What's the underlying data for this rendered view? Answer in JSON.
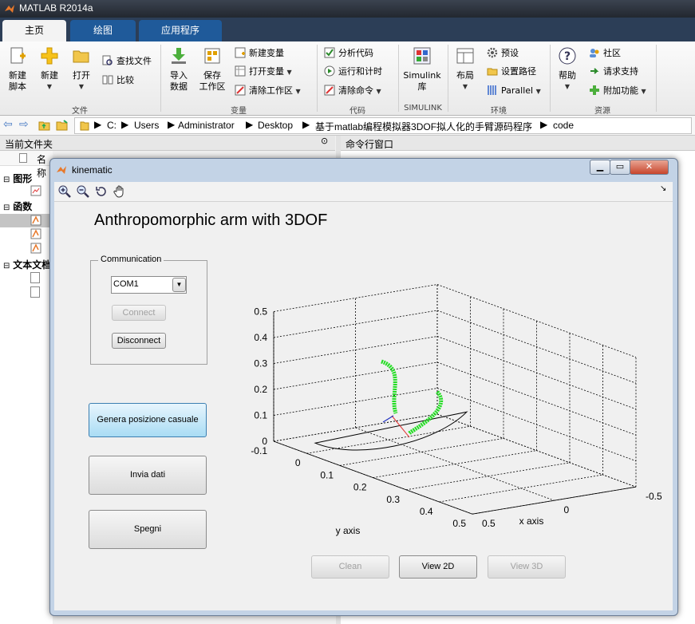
{
  "app": {
    "title": "MATLAB R2014a"
  },
  "tabs": [
    {
      "label": "主页"
    },
    {
      "label": "绘图"
    },
    {
      "label": "应用程序"
    }
  ],
  "ribbon": {
    "file": {
      "new_script": "新建\n脚本",
      "new": "新建",
      "open": "打开",
      "find_files": "查找文件",
      "compare": "比较",
      "group": "文件"
    },
    "variable": {
      "import": "导入\n数据",
      "save_ws": "保存\n工作区",
      "new_var": "新建变量",
      "open_var": "打开变量",
      "clear_ws": "清除工作区",
      "group": "变量"
    },
    "code": {
      "analyze": "分析代码",
      "run_time": "运行和计时",
      "clear_cmd": "清除命令",
      "group": "代码"
    },
    "simulink": {
      "lib": "Simulink\n库",
      "group": "SIMULINK"
    },
    "env": {
      "layout": "布局",
      "prefs": "预设",
      "set_path": "设置路径",
      "parallel": "Parallel",
      "group": "环境"
    },
    "resources": {
      "help": "帮助",
      "community": "社区",
      "support": "请求支持",
      "addons": "附加功能",
      "group": "资源"
    }
  },
  "address": {
    "parts": [
      "C:",
      "Users",
      "Administrator",
      "Desktop",
      "基于matlab编程模拟器3DOF拟人化的手臂源码程序",
      "code"
    ]
  },
  "panels": {
    "current_folder": "当前文件夹",
    "name_col": "名称",
    "command_window": "命令行窗口",
    "tree": {
      "figures": "图形",
      "functions": "函数",
      "text_docs": "文本文档"
    }
  },
  "figure": {
    "title": "kinematic",
    "heading": "Anthropomorphic arm with 3DOF",
    "communication": {
      "group": "Communication",
      "port": "COM1",
      "connect": "Connect",
      "disconnect": "Disconnect"
    },
    "buttons": {
      "random": "Genera posizione casuale",
      "send": "Invia dati",
      "off": "Spegni",
      "clean": "Clean",
      "view2d": "View 2D",
      "view3d": "View 3D"
    }
  },
  "chart_data": {
    "type": "line",
    "view": "3d",
    "xlabel": "x axis",
    "ylabel": "y axis",
    "zticks": [
      "0",
      "0.1",
      "0.2",
      "0.3",
      "0.4",
      "0.5"
    ],
    "yticks": [
      "-0.1",
      "0",
      "0.1",
      "0.2",
      "0.3",
      "0.4",
      "0.5"
    ],
    "xticks": [
      "-0.5",
      "0",
      "0.5"
    ],
    "grid": true,
    "colors": {
      "arm_path": "#22dd22",
      "link_red": "#e03030",
      "link_blue": "#2030c0"
    }
  }
}
